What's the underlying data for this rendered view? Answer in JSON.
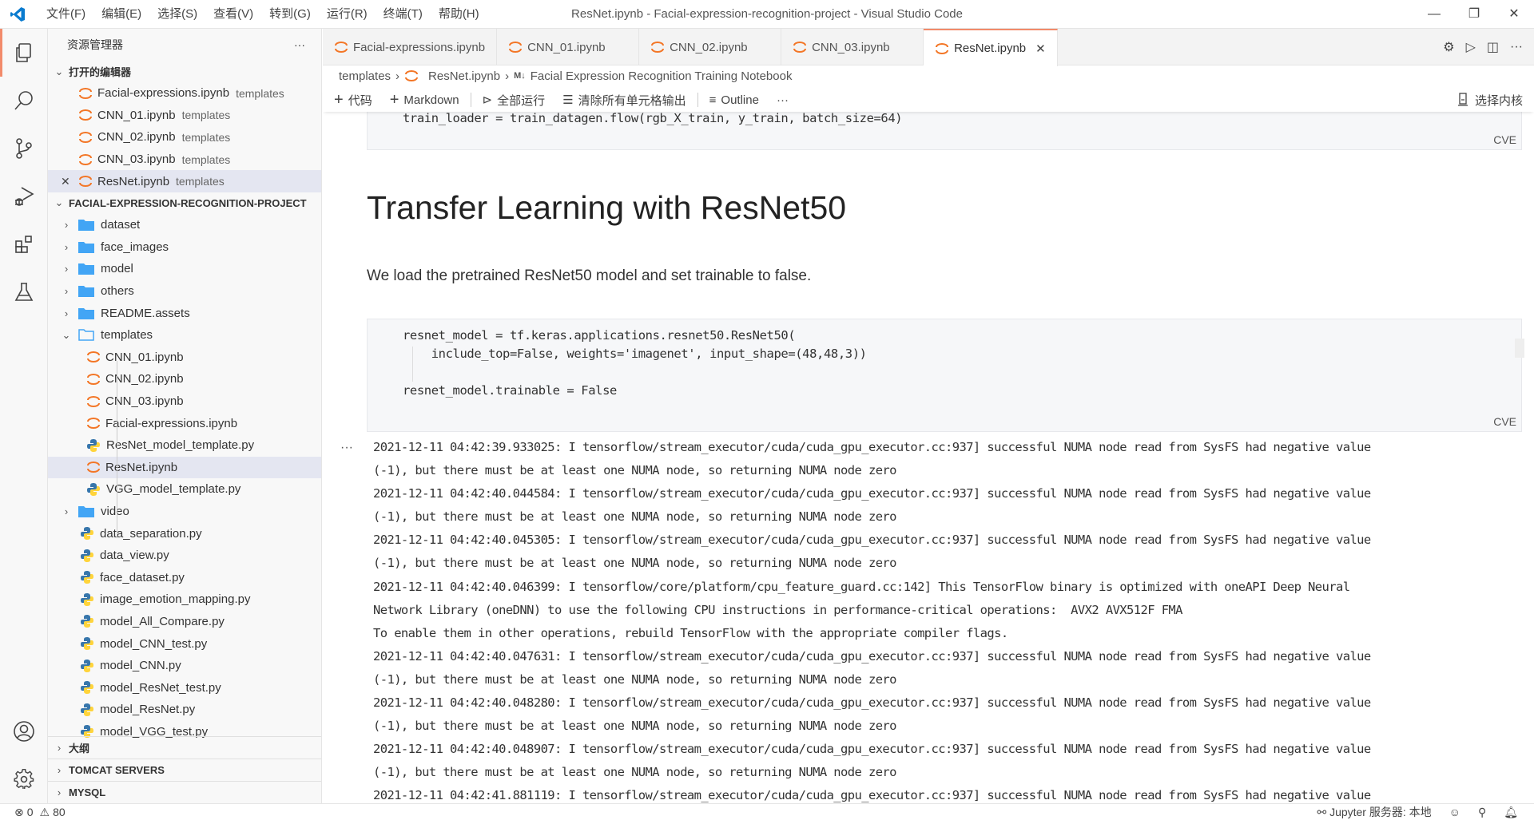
{
  "window": {
    "title": "ResNet.ipynb - Facial-expression-recognition-project - Visual Studio Code",
    "menu": [
      "文件(F)",
      "编辑(E)",
      "选择(S)",
      "查看(V)",
      "转到(G)",
      "运行(R)",
      "终端(T)",
      "帮助(H)"
    ],
    "controls": {
      "minimize": "—",
      "restore": "❐",
      "close": "✕"
    }
  },
  "activity_bar": {
    "items": [
      "explorer-icon",
      "search-icon",
      "source-control-icon",
      "run-debug-icon",
      "extensions-icon",
      "testing-icon"
    ],
    "bottom": [
      "account-icon",
      "manage-gear-icon"
    ]
  },
  "sidebar": {
    "title": "资源管理器",
    "more": "···",
    "open_editors": {
      "label": "打开的编辑器",
      "items": [
        {
          "name": "Facial-expressions.ipynb",
          "desc": "templates"
        },
        {
          "name": "CNN_01.ipynb",
          "desc": "templates"
        },
        {
          "name": "CNN_02.ipynb",
          "desc": "templates"
        },
        {
          "name": "CNN_03.ipynb",
          "desc": "templates"
        },
        {
          "name": "ResNet.ipynb",
          "desc": "templates",
          "close": "✕"
        }
      ]
    },
    "project": {
      "label": "FACIAL-EXPRESSION-RECOGNITION-PROJECT",
      "folders": [
        "dataset",
        "face_images",
        "model",
        "others",
        "README.assets"
      ],
      "templates_folder": "templates",
      "template_files": [
        {
          "name": "CNN_01.ipynb",
          "type": "notebook"
        },
        {
          "name": "CNN_02.ipynb",
          "type": "notebook"
        },
        {
          "name": "CNN_03.ipynb",
          "type": "notebook"
        },
        {
          "name": "Facial-expressions.ipynb",
          "type": "notebook"
        },
        {
          "name": "ResNet_model_template.py",
          "type": "python"
        },
        {
          "name": "ResNet.ipynb",
          "type": "notebook"
        },
        {
          "name": "VGG_model_template.py",
          "type": "python"
        }
      ],
      "video_folder": "video",
      "root_files": [
        "data_separation.py",
        "data_view.py",
        "face_dataset.py",
        "image_emotion_mapping.py",
        "model_All_Compare.py",
        "model_CNN_test.py",
        "model_CNN.py",
        "model_ResNet_test.py",
        "model_ResNet.py",
        "model_VGG_test.py"
      ]
    },
    "bottom_sections": [
      "大纲",
      "TOMCAT SERVERS",
      "MYSQL"
    ]
  },
  "tabs": [
    {
      "label": "Facial-expressions.ipynb"
    },
    {
      "label": "CNN_01.ipynb"
    },
    {
      "label": "CNN_02.ipynb"
    },
    {
      "label": "CNN_03.ipynb"
    },
    {
      "label": "ResNet.ipynb",
      "active": true,
      "close": "✕"
    }
  ],
  "breadcrumb": {
    "folder": "templates",
    "file": "ResNet.ipynb",
    "md_badge": "M↓",
    "section": "Facial Expression Recognition Training Notebook",
    "sep": "›"
  },
  "toolbar": {
    "add_code": "代码",
    "add_markdown": "Markdown",
    "run_all": "全部运行",
    "clear_outputs": "清除所有单元格输出",
    "outline": "Outline",
    "more": "···",
    "select_kernel": "选择内核"
  },
  "notebook": {
    "cell1": {
      "lines": [
        "train_loader = train_datagen.flow(rgb_X_train, y_train, batch_size=64)"
      ],
      "lang": "CVE"
    },
    "markdown": {
      "heading": "Transfer Learning with ResNet50",
      "paragraph": "We load the pretrained ResNet50 model and set trainable to false."
    },
    "cell2": {
      "lines": [
        "resnet_model = tf.keras.applications.resnet50.ResNet50(",
        "    include_top=False, weights='imagenet', input_shape=(48,48,3))",
        "",
        "resnet_model.trainable = False"
      ],
      "lang": "CVE"
    },
    "output_more": "···",
    "output_lines": [
      "2021-12-11 04:42:39.933025: I tensorflow/stream_executor/cuda/cuda_gpu_executor.cc:937] successful NUMA node read from SysFS had negative value",
      "(-1), but there must be at least one NUMA node, so returning NUMA node zero",
      "2021-12-11 04:42:40.044584: I tensorflow/stream_executor/cuda/cuda_gpu_executor.cc:937] successful NUMA node read from SysFS had negative value",
      "(-1), but there must be at least one NUMA node, so returning NUMA node zero",
      "2021-12-11 04:42:40.045305: I tensorflow/stream_executor/cuda/cuda_gpu_executor.cc:937] successful NUMA node read from SysFS had negative value",
      "(-1), but there must be at least one NUMA node, so returning NUMA node zero",
      "2021-12-11 04:42:40.046399: I tensorflow/core/platform/cpu_feature_guard.cc:142] This TensorFlow binary is optimized with oneAPI Deep Neural",
      "Network Library (oneDNN) to use the following CPU instructions in performance-critical operations:  AVX2 AVX512F FMA",
      "To enable them in other operations, rebuild TensorFlow with the appropriate compiler flags.",
      "2021-12-11 04:42:40.047631: I tensorflow/stream_executor/cuda/cuda_gpu_executor.cc:937] successful NUMA node read from SysFS had negative value",
      "(-1), but there must be at least one NUMA node, so returning NUMA node zero",
      "2021-12-11 04:42:40.048280: I tensorflow/stream_executor/cuda/cuda_gpu_executor.cc:937] successful NUMA node read from SysFS had negative value",
      "(-1), but there must be at least one NUMA node, so returning NUMA node zero",
      "2021-12-11 04:42:40.048907: I tensorflow/stream_executor/cuda/cuda_gpu_executor.cc:937] successful NUMA node read from SysFS had negative value",
      "(-1), but there must be at least one NUMA node, so returning NUMA node zero",
      "2021-12-11 04:42:41.881119: I tensorflow/stream_executor/cuda/cuda_gpu_executor.cc:937] successful NUMA node read from SysFS had negative value"
    ]
  },
  "statusbar": {
    "errors": "0",
    "warnings": "80",
    "jupyter": "Jupyter 服务器: 本地"
  },
  "colors": {
    "accent": "#f28b6b",
    "notebook_icon": "#f37626",
    "folder": "#42a5f5",
    "python_blue": "#3776ab",
    "python_yellow": "#ffd43b"
  }
}
